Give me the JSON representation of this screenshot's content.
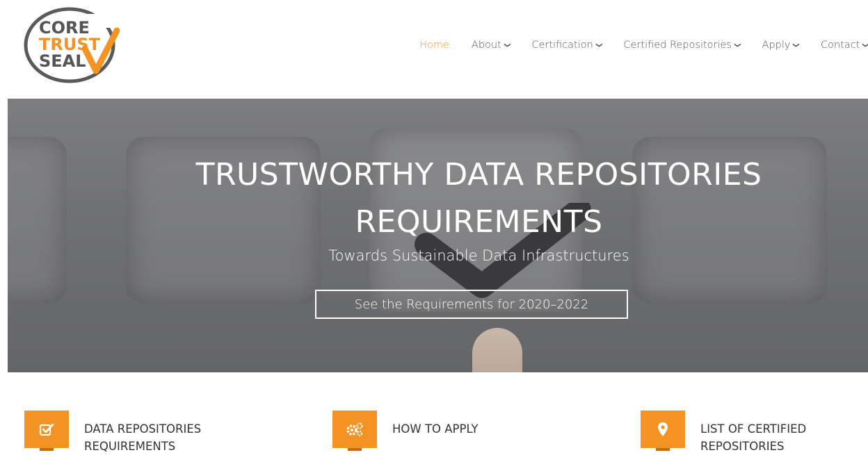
{
  "logo": {
    "line1": "CORE",
    "line2": "TRUST",
    "line3": "SEAL",
    "colors": {
      "ring": "#555555",
      "accent": "#f39323",
      "text_dark": "#555555"
    }
  },
  "nav": {
    "items": [
      {
        "label": "Home",
        "active": true,
        "has_dropdown": false
      },
      {
        "label": "About",
        "active": false,
        "has_dropdown": true
      },
      {
        "label": "Certification",
        "active": false,
        "has_dropdown": true
      },
      {
        "label": "Certified Repositories",
        "active": false,
        "has_dropdown": true
      },
      {
        "label": "Apply",
        "active": false,
        "has_dropdown": true
      },
      {
        "label": "Contact",
        "active": false,
        "has_dropdown": true
      }
    ],
    "dropdown_icon": "chevron-down-icon",
    "active_color": "#f0932b"
  },
  "hero": {
    "title_line1": "TRUSTWORTHY DATA REPOSITORIES",
    "title_line2": "REQUIREMENTS",
    "subtitle": "Towards Sustainable Data Infrastructures",
    "cta_label": "See the Requirements for 2020–2022"
  },
  "features": [
    {
      "icon": "checkbox-icon",
      "line1": "DATA REPOSITORIES",
      "line2": "REQUIREMENTS"
    },
    {
      "icon": "gears-icon",
      "line1": "HOW TO APPLY",
      "line2": ""
    },
    {
      "icon": "map-marker-icon",
      "line1": "LIST OF CERTIFIED",
      "line2": "REPOSITORIES"
    }
  ],
  "colors": {
    "accent": "#f39323"
  }
}
